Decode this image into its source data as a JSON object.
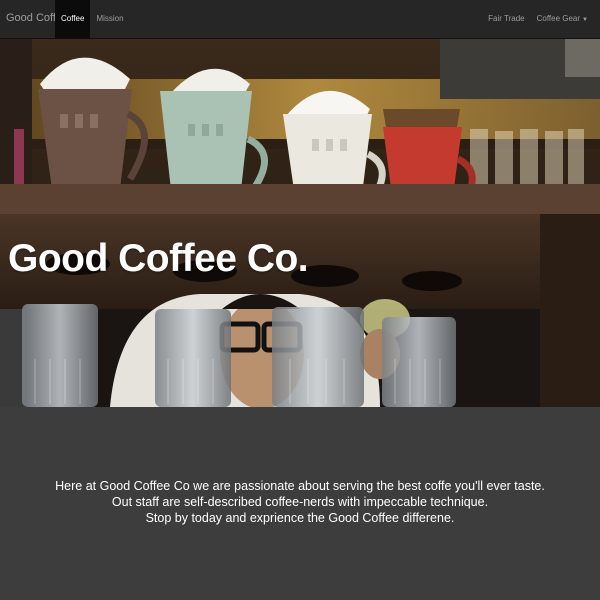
{
  "navbar": {
    "brand": "Good Coffee",
    "left_items": [
      {
        "label": "Coffee",
        "active": true
      },
      {
        "label": "Mission",
        "active": false
      }
    ],
    "right_items": [
      {
        "label": "Fair Trade"
      },
      {
        "label": "Coffee Gear",
        "has_dropdown": true
      }
    ]
  },
  "hero": {
    "title": "Good Coffee Co."
  },
  "intro": {
    "lines": [
      "Here at Good Coffee Co we are passionate about serving the best coffe you'll ever taste.",
      "Out staff are self-described coffee-nerds with impeccable technique.",
      "Stop by today and exprience the Good Coffee differene."
    ]
  },
  "colors": {
    "navbar_bg": "#262626",
    "page_bg": "#3d3d3d",
    "text_light": "#ffffff",
    "nav_text": "#9d9d9d"
  }
}
